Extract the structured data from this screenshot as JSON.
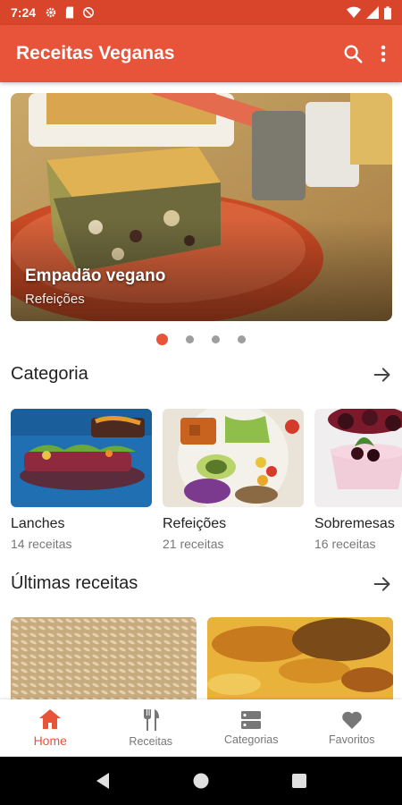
{
  "status_bar": {
    "time": "7:24"
  },
  "app_bar": {
    "title": "Receitas Veganas"
  },
  "carousel": {
    "title": "Empadão vegano",
    "subtitle": "Refeições",
    "pages": 4,
    "active_page": 1
  },
  "sections": {
    "categories_title": "Categoria",
    "latest_title": "Últimas receitas"
  },
  "categories": [
    {
      "name": "Lanches",
      "count": "14 receitas"
    },
    {
      "name": "Refeições",
      "count": "21 receitas"
    },
    {
      "name": "Sobremesas",
      "count": "16 receitas"
    }
  ],
  "bottom_nav": {
    "home": "Home",
    "recipes": "Receitas",
    "categories": "Categorias",
    "favorites": "Favoritos",
    "active": "home"
  },
  "colors": {
    "accent": "#e7543a",
    "status_bar": "#d8452b",
    "inactive": "#777777"
  }
}
